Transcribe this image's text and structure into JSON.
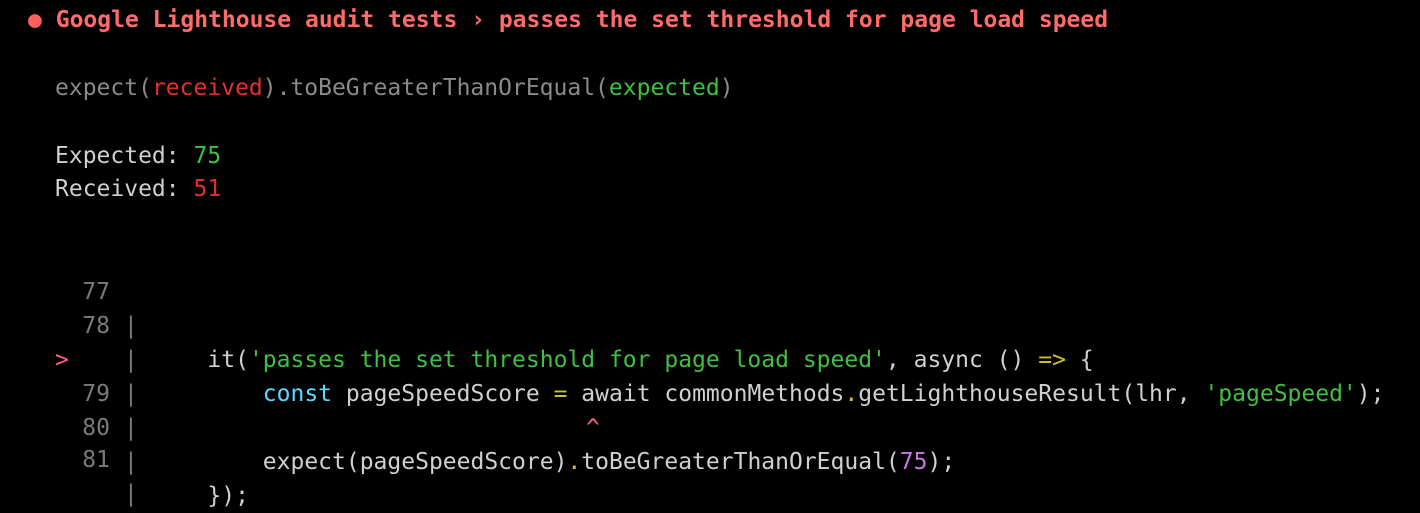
{
  "test": {
    "bullet": "●",
    "title": "Google Lighthouse audit tests › passes the set threshold for page load speed"
  },
  "matcher": {
    "prefix": "expect(",
    "received": "received",
    "middle": ").toBeGreaterThanOrEqual(",
    "expected": "expected",
    "suffix": ")"
  },
  "comparison": {
    "expected_label": "Expected: ",
    "expected_value": "75",
    "received_label": "Received: ",
    "received_value": "51"
  },
  "code_frame": {
    "highlight_marker": ">",
    "pipe": "|",
    "caret": "^",
    "lines": [
      {
        "number": "77",
        "indent": "    ",
        "it": "it(",
        "str": "'passes the set threshold for page load speed'",
        "comma": ", async () ",
        "arrow": "=>",
        "brace": " {"
      },
      {
        "number": "78",
        "indent": "        ",
        "kw": "const",
        "var": " pageSpeedScore ",
        "eq": "=",
        "await": " await commonMethods",
        "dot": ".",
        "call": "getLighthouseResult(lhr, ",
        "str": "'pageSpeed'",
        "end": ");"
      },
      {
        "number": "79",
        "indent": "        ",
        "expect": "expect(pageSpeedScore)",
        "dot": ".",
        "call": "toBeGreaterThanOrEqual(",
        "num": "75",
        "end": ");"
      },
      {
        "number": "80",
        "indent": "    ",
        "close": "});"
      },
      {
        "number": "81"
      }
    ]
  },
  "colors": {
    "background": "#000000",
    "title": "#ff6b6b",
    "received": "#e2302b",
    "expected": "#3ec13e",
    "string": "#40c040",
    "keyword": "#5fd7ff",
    "number": "#c678dd",
    "punctuation": "#c9c12e"
  }
}
